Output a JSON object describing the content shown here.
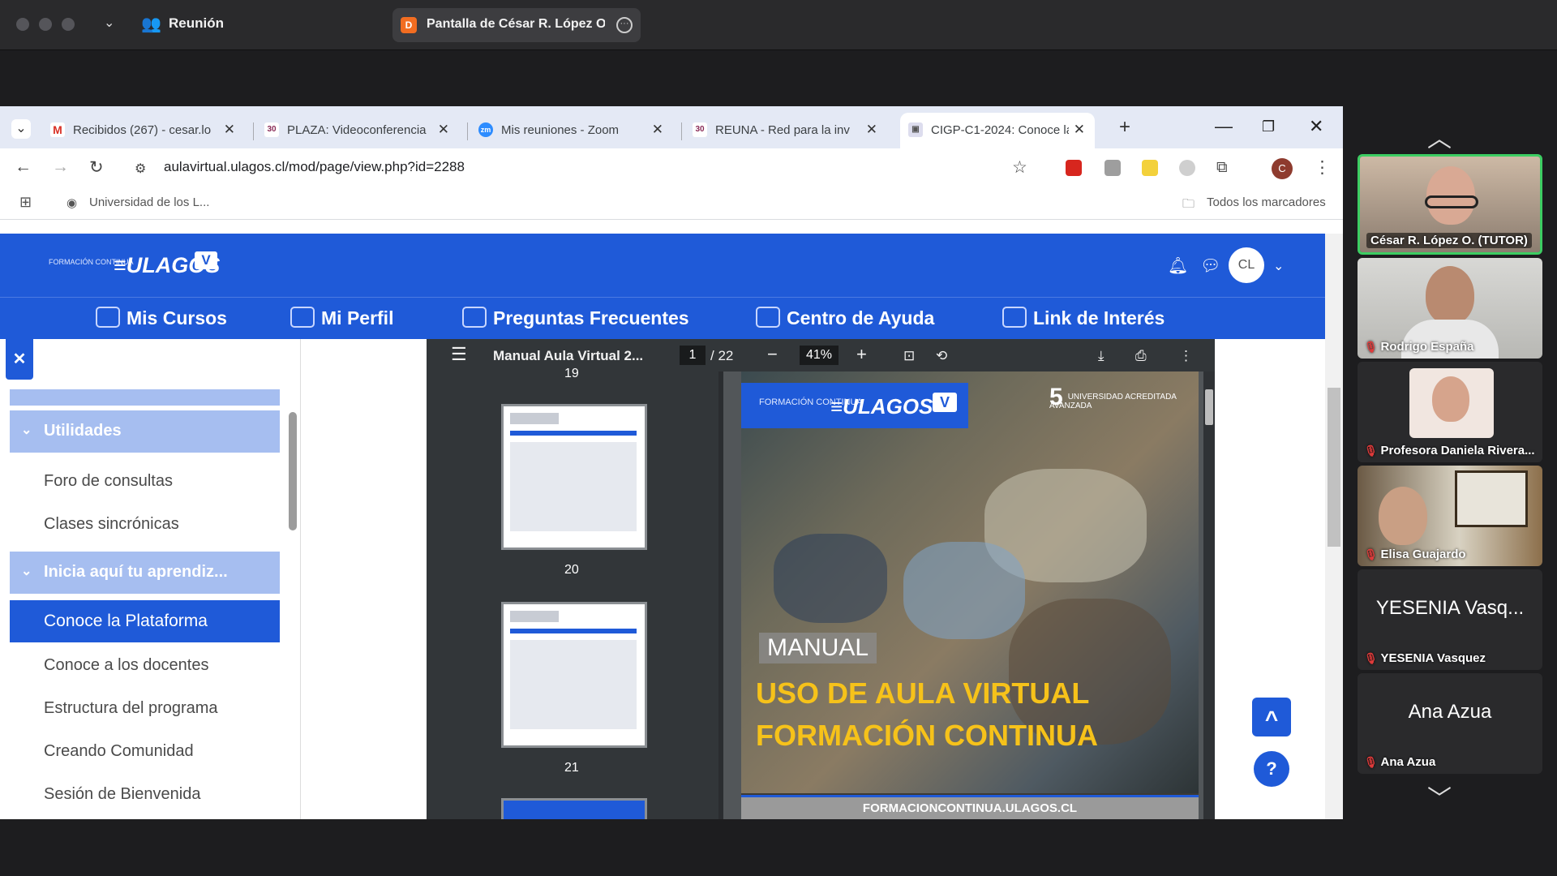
{
  "zoom": {
    "meeting_label": "Reunión",
    "share_banner": "Pantalla de César R. López O.",
    "share_badge": "D"
  },
  "browser": {
    "tabs": [
      {
        "title": "Recibidos (267) - cesar.lo",
        "favicon": "gmail-icon"
      },
      {
        "title": "PLAZA: Videoconferencia",
        "favicon": "plaza-icon"
      },
      {
        "title": "Mis reuniones - Zoom",
        "favicon": "zoom-icon"
      },
      {
        "title": "REUNA - Red para la inv",
        "favicon": "reuna-icon"
      },
      {
        "title": "CIGP-C1-2024: Conoce la",
        "favicon": "moodle-icon"
      }
    ],
    "url": "aulavirtual.ulagos.cl/mod/page/view.php?id=2288",
    "profile_initial": "C",
    "bookmark": "Universidad de los L...",
    "all_bookmarks": "Todos los marcadores"
  },
  "site": {
    "logo_small": "FORMACIÓN CONTINUA",
    "logo_main": "ULAGOS",
    "logo_badge": "V",
    "user_initials": "CL",
    "nav": [
      "Mis Cursos",
      "Mi Perfil",
      "Preguntas Frecuentes",
      "Centro de Ayuda",
      "Link de Interés"
    ]
  },
  "sidebar": {
    "close": "✕",
    "section1": "Utilidades",
    "section1_items": [
      "Foro de consultas",
      "Clases sincrónicas"
    ],
    "section2": "Inicia aquí tu aprendiz...",
    "active_item": "Conoce la Plataforma",
    "section2_items": [
      "Conoce a los docentes",
      "Estructura del programa",
      "Creando Comunidad",
      "Sesión de Bienvenida"
    ]
  },
  "pdf": {
    "title": "Manual Aula Virtual 2...",
    "page": "1",
    "pages_total": "/ 22",
    "zoom": "41%",
    "thumb_prev": "19",
    "thumbs": [
      "20",
      "21"
    ],
    "cover": {
      "logo_small": "FORMACIÓN CONTINUA",
      "logo_main": "ULAGOS",
      "logo_badge": "V",
      "accreditation_years": "5",
      "accreditation_text": "UNIVERSIDAD ACREDITADA AVANZADA",
      "manual": "MANUAL",
      "title_line1": "USO DE AULA VIRTUAL",
      "title_line2": "FORMACIÓN CONTINUA",
      "footer": "FORMACIONCONTINUA.ULAGOS.CL"
    }
  },
  "help": {
    "top": "^",
    "question": "?"
  },
  "participants": [
    {
      "name": "César R. López O. (TUTOR)",
      "video": true,
      "muted": false,
      "active": true
    },
    {
      "name": "Rodrigo España",
      "video": true,
      "muted": true
    },
    {
      "name": "Profesora Daniela Rivera...",
      "video": true,
      "muted": true
    },
    {
      "name": "Elisa Guajardo",
      "video": true,
      "muted": true
    },
    {
      "name": "YESENIA Vasquez",
      "display": "YESENIA Vasq...",
      "video": false,
      "muted": true
    },
    {
      "name": "Ana Azua",
      "display": "Ana Azua",
      "video": false,
      "muted": true
    }
  ],
  "colors": {
    "brand_blue": "#1f5ad8",
    "title_yellow": "#f6c21a",
    "active_speaker": "#3ccd62"
  }
}
